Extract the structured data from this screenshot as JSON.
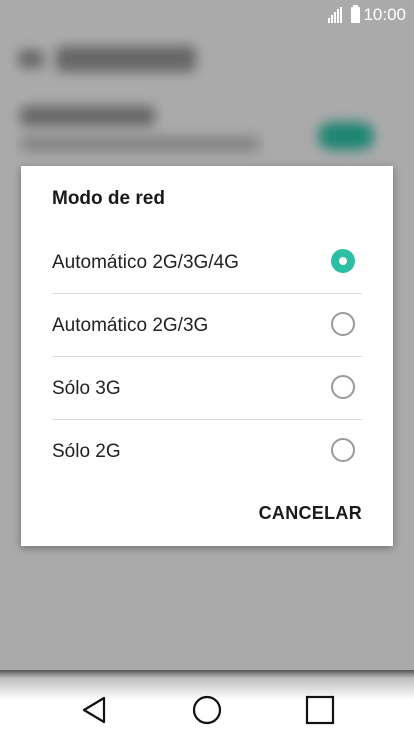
{
  "status_bar": {
    "time": "10:00",
    "icons": [
      "signal-icon",
      "battery-icon"
    ]
  },
  "dialog": {
    "title": "Modo de red",
    "options": [
      {
        "label": "Automático 2G/3G/4G",
        "selected": true
      },
      {
        "label": "Automático 2G/3G",
        "selected": false
      },
      {
        "label": "Sólo 3G",
        "selected": false
      },
      {
        "label": "Sólo 2G",
        "selected": false
      }
    ],
    "cancel_label": "CANCELAR"
  },
  "navigation": {
    "buttons": [
      "back-icon",
      "home-icon",
      "recents-icon"
    ]
  },
  "colors": {
    "accent": "#2bbfa4",
    "scrim": "#000000"
  }
}
